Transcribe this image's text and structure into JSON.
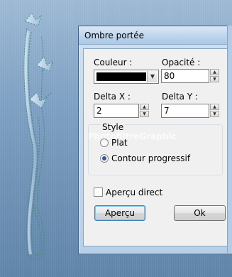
{
  "dialog": {
    "title": "Ombre portée",
    "couleur_label": "Couleur :",
    "couleur_value": "#000000",
    "opacite_label": "Opacité :",
    "opacite_value": "80",
    "delta_x_label": "Delta X :",
    "delta_x_value": "2",
    "delta_y_label": "Delta Y :",
    "delta_y_value": "7",
    "style_label": "Style",
    "watermark": "PhotofiltreGraphic",
    "radio_plat_label": "Plat",
    "radio_contour_label": "Contour progressif",
    "radio_selected": "Contour progressif",
    "apercu_direct_label": "Aperçu direct",
    "apercu_direct_checked": false,
    "apercu_button": "Aperçu",
    "ok_button": "Ok"
  }
}
